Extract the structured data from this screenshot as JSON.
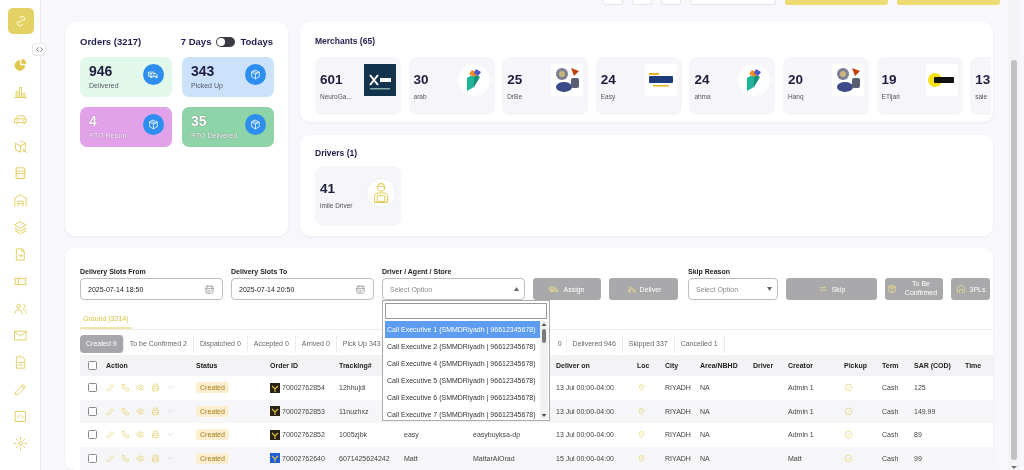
{
  "sidebar": {
    "items": [
      {
        "selected": true
      },
      {
        "selected": false
      },
      {
        "selected": false
      },
      {
        "selected": false
      },
      {
        "selected": false
      },
      {
        "selected": false
      },
      {
        "selected": false
      },
      {
        "selected": false
      },
      {
        "selected": false
      },
      {
        "selected": false
      },
      {
        "selected": false
      },
      {
        "selected": false
      },
      {
        "selected": false
      },
      {
        "selected": false
      },
      {
        "selected": false
      }
    ]
  },
  "orders": {
    "title": "Orders (3217)",
    "range_left": "7 Days",
    "range_right": "Todays",
    "toggle_on": false,
    "tiles": [
      {
        "value": "946",
        "label": "Delivered",
        "color": "#e2f8ea",
        "kind": "truck",
        "inverted": false
      },
      {
        "value": "343",
        "label": "Picked Up",
        "color": "#cce2fb",
        "kind": "box",
        "inverted": false
      },
      {
        "value": "4",
        "label": "RTO Return",
        "color": "#e2a2ea",
        "kind": "box",
        "inverted": true
      },
      {
        "value": "35",
        "label": "RTO Delivered",
        "color": "#8fd4a8",
        "kind": "box",
        "inverted": true
      }
    ]
  },
  "merchants": {
    "title": "Merchants (65)",
    "items": [
      {
        "value": "601",
        "name": "NeuroGa...",
        "kind": "dark"
      },
      {
        "value": "30",
        "name": "arab",
        "kind": "isometric"
      },
      {
        "value": "25",
        "name": "DrBe",
        "kind": "gadgets"
      },
      {
        "value": "24",
        "name": "Easy",
        "kind": "light"
      },
      {
        "value": "24",
        "name": "ahma",
        "kind": "isometric"
      },
      {
        "value": "20",
        "name": "Hanq",
        "kind": "gadgets"
      },
      {
        "value": "19",
        "name": "ETijari",
        "kind": "dot"
      },
      {
        "value": "13",
        "name": "sale",
        "kind": "none"
      }
    ]
  },
  "drivers": {
    "title": "Drivers (1)",
    "items": [
      {
        "value": "41",
        "name": "imile Driver"
      }
    ]
  },
  "filters": {
    "from": {
      "label": "Delivery Slots From",
      "value": "2025-07-14 18:50"
    },
    "to": {
      "label": "Delivery Slots To",
      "value": "2025-07-14 20:50"
    },
    "driver": {
      "label": "Driver / Agent / Store",
      "placeholder": "Select Option",
      "expanded": true,
      "options": [
        {
          "label": "Call Executive 1 (SMMDRiyadh | 96612345678)",
          "selected": true
        },
        {
          "label": "Call Executive 2 (SMMDRiyadh | 96612345678)",
          "selected": false
        },
        {
          "label": "Call Executive 4 (SMMDRiyadh | 96612345678)",
          "selected": false
        },
        {
          "label": "Call Executive 5 (SMMDRiyadh | 96612345678)",
          "selected": false
        },
        {
          "label": "Call Executive 6 (SMMDRiyadh | 96612345678)",
          "selected": false
        },
        {
          "label": "Call Executive 7 (SMMDRiyadh | 96612345678)",
          "selected": false
        }
      ]
    },
    "assign": "Assign",
    "deliver": "Deliver",
    "skip_reason": {
      "label": "Skip Reason",
      "placeholder": "Select Option"
    },
    "skip": "Skip",
    "to_be_confirmed": "To Be Confirmed",
    "tpl": "3PLs"
  },
  "groups": [
    {
      "label": "Ground (3214)",
      "selected": true
    }
  ],
  "tabs": [
    {
      "label": "Created 9",
      "selected": true
    },
    {
      "label": "To be Confirmed 2",
      "selected": false
    },
    {
      "label": "Dispatched 0",
      "selected": false
    },
    {
      "label": "Accepted 0",
      "selected": false
    },
    {
      "label": "Arrived 0",
      "selected": false
    },
    {
      "label": "Pick Up 343",
      "selected": false
    },
    {
      "label": "0",
      "selected": false,
      "kind": "covered"
    },
    {
      "label": "Delivered 946",
      "selected": false
    },
    {
      "label": "Skipped 337",
      "selected": false
    },
    {
      "label": "Cancelled 1",
      "selected": false
    }
  ],
  "table": {
    "select_all_checked": false,
    "columns": [
      "Action",
      "Status",
      "Order ID",
      "Tracking#",
      "",
      "",
      "Deliver on",
      "Loc",
      "City",
      "Area/NBHD",
      "Driver",
      "Creator",
      "Pickup",
      "Term",
      "SAR (COD)",
      "Time"
    ],
    "rows": [
      {
        "checked": false,
        "status": "Created",
        "order_id": "70002762854",
        "color": "#2b2414",
        "tracking": "12hhujdi",
        "deliver_on": "13 Jul 00:00-04:00",
        "city": "RIYADH",
        "area": "NA",
        "creator": "Admin 1",
        "term": "Cash",
        "sar": "125"
      },
      {
        "checked": false,
        "status": "Created",
        "order_id": "70002762853",
        "color": "#2b2414",
        "tracking": "11nuzhxz",
        "deliver_on": "13 Jul 00:00-04:00",
        "city": "RIYADH",
        "area": "NA",
        "creator": "Admin 1",
        "term": "Cash",
        "sar": "149.99"
      },
      {
        "checked": false,
        "status": "Created",
        "order_id": "70002762852",
        "color": "#2b2414",
        "tracking": "1005zjbk",
        "column_6": "easy",
        "column_7": "easybuyksa-dp",
        "deliver_on": "13 Jul 00:00-04:00",
        "city": "RIYADH",
        "area": "NA",
        "creator": "Admin 1",
        "term": "Cash",
        "sar": "89"
      },
      {
        "checked": false,
        "status": "Created",
        "order_id": "70002762640",
        "color": "#1e5fd8",
        "tracking": "6071425624242",
        "column_6": "Matt",
        "column_7": "MattarAlOrad",
        "deliver_on": "15 Jul 00:00-04:00",
        "city": "RIYADH",
        "area": "NA",
        "creator": "Matt",
        "term": "Cash",
        "sar": "99"
      }
    ]
  }
}
